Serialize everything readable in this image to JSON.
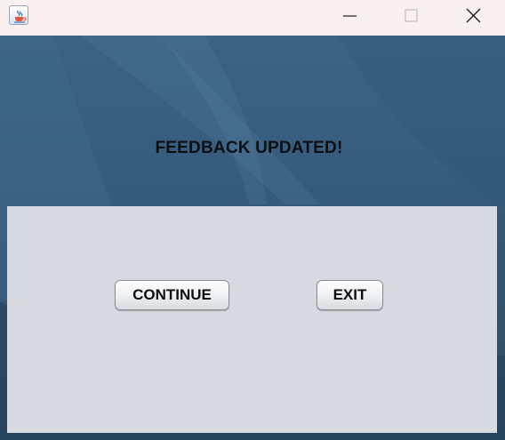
{
  "window": {
    "icon": "java-cup-icon",
    "controls": {
      "minimize": "minimize-icon",
      "maximize": "maximize-icon",
      "close": "close-icon"
    }
  },
  "message": {
    "text": "FEEDBACK UPDATED!"
  },
  "buttons": {
    "continue_label": "CONTINUE",
    "exit_label": "EXIT"
  },
  "colors": {
    "titlebar": "#f9f0ef",
    "background": "#3c6384",
    "panel": "#d8dae1"
  }
}
